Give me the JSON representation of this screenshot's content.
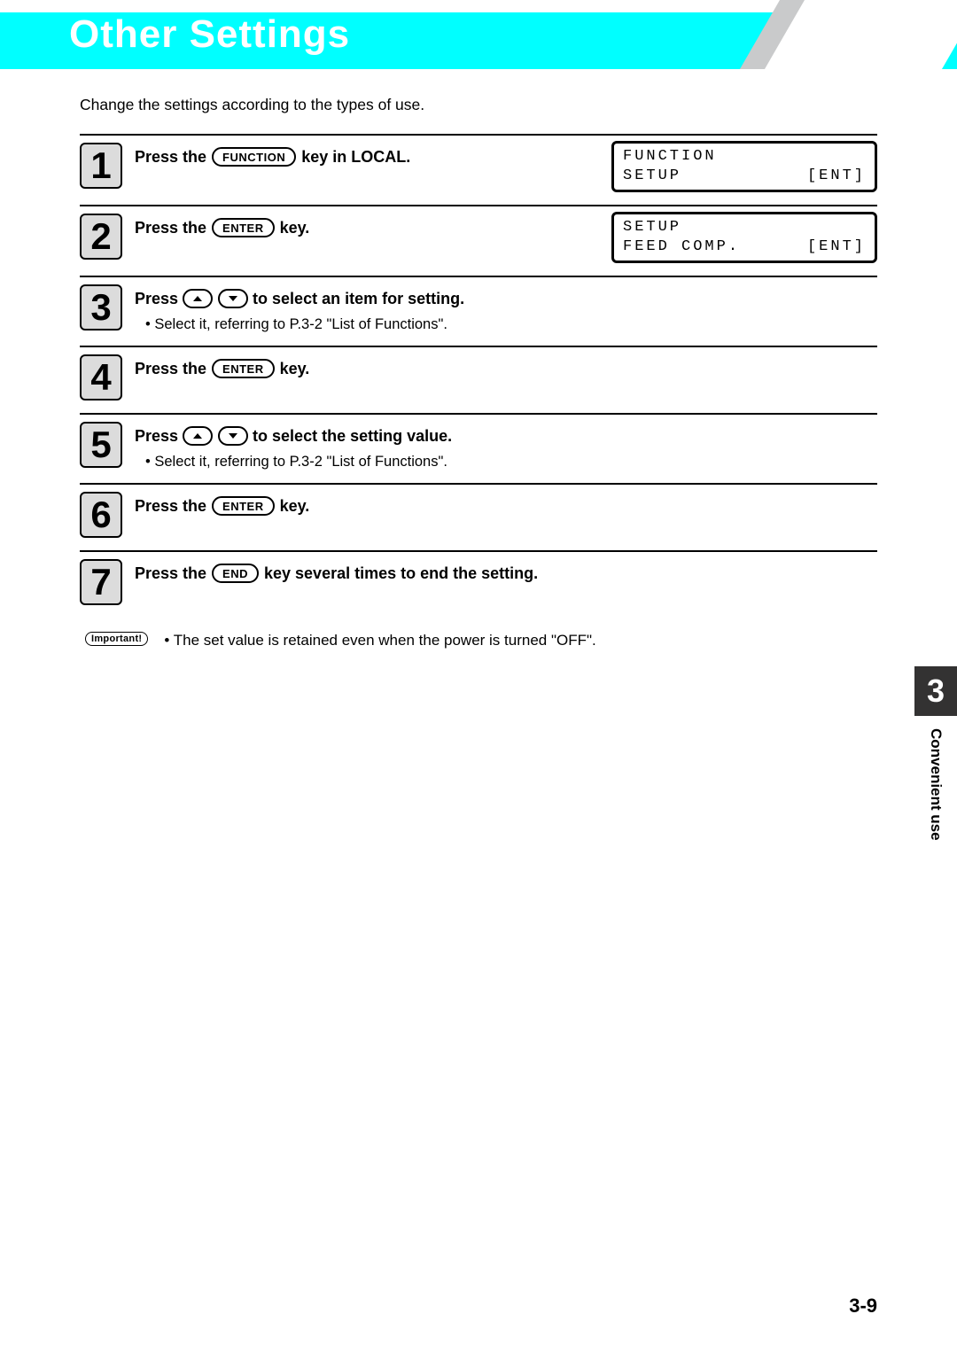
{
  "header": {
    "title": "Other Settings"
  },
  "intro": "Change the settings according to the types of use.",
  "steps": [
    {
      "num": "1",
      "parts": [
        "Press the ",
        {
          "key": "FUNCTION"
        },
        " key in LOCAL."
      ],
      "lcd": {
        "line1": "FUNCTION",
        "line2_left": "SETUP",
        "line2_right": "[ENT]"
      }
    },
    {
      "num": "2",
      "parts": [
        "Press the ",
        {
          "key": "ENTER"
        },
        " key."
      ],
      "lcd": {
        "line1": "SETUP",
        "line2_left": "FEED COMP.",
        "line2_right": "[ENT]"
      }
    },
    {
      "num": "3",
      "parts": [
        "Press ",
        {
          "arrow": "up"
        },
        {
          "arrow": "down"
        },
        " to select an item for setting."
      ],
      "note": "• Select it, referring to P.3-2 \"List of Functions\"."
    },
    {
      "num": "4",
      "parts": [
        "Press the ",
        {
          "key": "ENTER"
        },
        " key."
      ]
    },
    {
      "num": "5",
      "parts": [
        "Press ",
        {
          "arrow": "up"
        },
        {
          "arrow": "down"
        },
        " to select the setting value."
      ],
      "note": "• Select it, referring to P.3-2 \"List of Functions\"."
    },
    {
      "num": "6",
      "parts": [
        "Press the ",
        {
          "key": "ENTER"
        },
        " key."
      ]
    },
    {
      "num": "7",
      "parts": [
        "Press the ",
        {
          "key": "END"
        },
        " key several times to end the setting."
      ]
    }
  ],
  "important": {
    "badge": "Important!",
    "text": "•  The set value is retained even when the power is turned \"OFF\"."
  },
  "side_tab": {
    "chapter": "3",
    "label": "Convenient use"
  },
  "page_number": "3-9"
}
